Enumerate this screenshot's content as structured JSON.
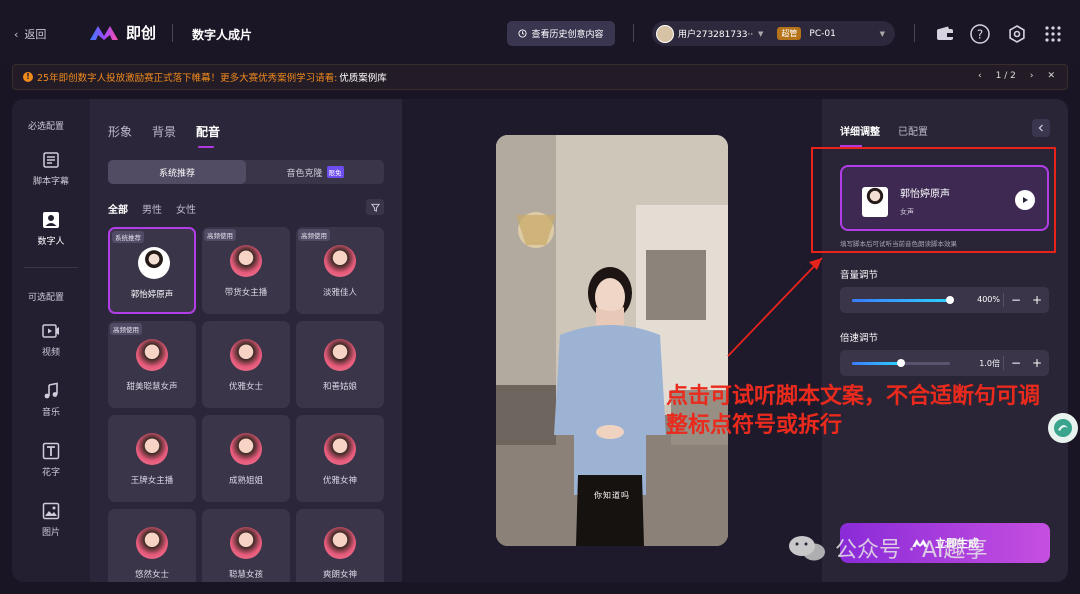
{
  "topbar": {
    "back": "返回",
    "app_name": "即创",
    "page_title": "数字人成片",
    "history_button": "查看历史创意内容",
    "user_name": "用户273281733···",
    "admin_badge": "超管",
    "device": "PC-01",
    "icons": [
      "wallet-icon",
      "help-icon",
      "settings-icon",
      "apps-grid-icon"
    ]
  },
  "banner": {
    "text": "25年即创数字人投放激励赛正式落下帷幕！更多大赛优秀案例学习请看:",
    "link": "优质案例库",
    "pager": "1 / 2"
  },
  "rail": {
    "required_header": "必选配置",
    "required_items": [
      {
        "label": "脚本字幕",
        "icon": "script-icon"
      },
      {
        "label": "数字人",
        "icon": "avatar-icon"
      }
    ],
    "optional_header": "可选配置",
    "optional_items": [
      {
        "label": "视频",
        "icon": "video-icon"
      },
      {
        "label": "音乐",
        "icon": "music-icon"
      },
      {
        "label": "花字",
        "icon": "text-effect-icon"
      },
      {
        "label": "图片",
        "icon": "image-icon"
      }
    ]
  },
  "voice_panel": {
    "tabs": [
      "形象",
      "背景",
      "配音"
    ],
    "active_tab": "配音",
    "segments": [
      "系统推荐",
      "音色克隆"
    ],
    "clone_badge": "限免",
    "filters": [
      "全部",
      "男性",
      "女性"
    ],
    "voices": [
      {
        "name": "郭怡婷原声",
        "tag": "系统推荐",
        "selected": true
      },
      {
        "name": "带货女主播",
        "tag": "高频使用"
      },
      {
        "name": "淡雅佳人",
        "tag": "高频使用"
      },
      {
        "name": "甜美聪慧女声",
        "tag": "高频使用"
      },
      {
        "name": "优雅女士",
        "tag": ""
      },
      {
        "name": "和善姑娘",
        "tag": ""
      },
      {
        "name": "王牌女主播",
        "tag": ""
      },
      {
        "name": "成熟姐姐",
        "tag": ""
      },
      {
        "name": "优雅女神",
        "tag": ""
      },
      {
        "name": "悠然女士",
        "tag": ""
      },
      {
        "name": "聪慧女孩",
        "tag": ""
      },
      {
        "name": "爽朗女神",
        "tag": ""
      }
    ]
  },
  "preview": {
    "subtitle": "你知道吗"
  },
  "settings": {
    "tabs": [
      "详细调整",
      "已配置"
    ],
    "selected_voice": {
      "name": "郭怡婷原声",
      "gender": "女声"
    },
    "hint": "填写脚本后可试听当前音色朗读脚本效果",
    "volume": {
      "label": "音量调节",
      "value": "400%",
      "fraction": 1.0
    },
    "speed": {
      "label": "倍速调节",
      "value": "1.0倍",
      "fraction": 0.5
    },
    "generate_button": "立即生成"
  },
  "annotation": {
    "text_line1": "点击可试听脚本文案，不合适断句可调",
    "text_line2": "整标点符号或拆行",
    "color": "#ea2a1c"
  },
  "watermark": {
    "text": "公众号 · AI趣享"
  },
  "colors": {
    "accent": "#b13ee6",
    "banner_text": "#f08a1c",
    "slider_fill": "#2ad3ff"
  }
}
